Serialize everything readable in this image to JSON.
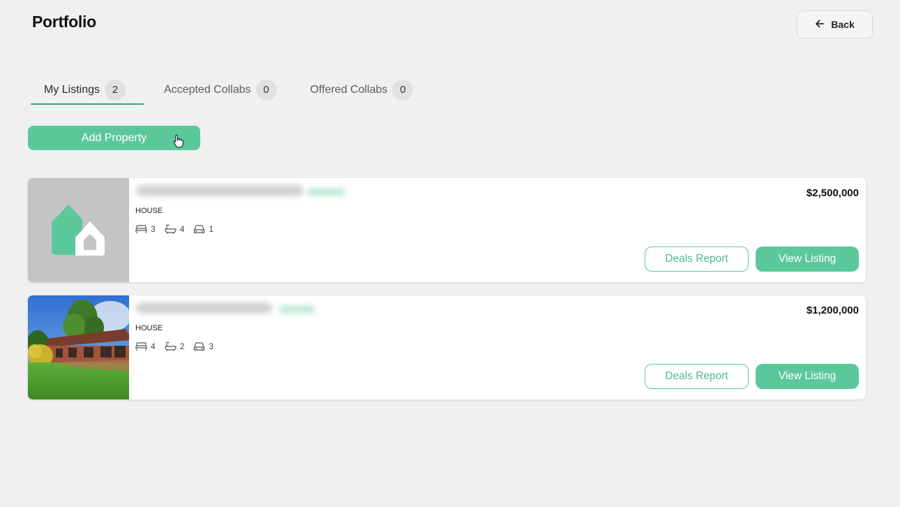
{
  "page": {
    "title": "Portfolio"
  },
  "header": {
    "back_label": "Back"
  },
  "tabs": [
    {
      "label": "My Listings",
      "count": "2",
      "active": true
    },
    {
      "label": "Accepted Collabs",
      "count": "0",
      "active": false
    },
    {
      "label": "Offered Collabs",
      "count": "0",
      "active": false
    }
  ],
  "actions": {
    "add_property_label": "Add Property"
  },
  "listings": [
    {
      "type": "HOUSE",
      "beds": "3",
      "baths": "4",
      "cars": "1",
      "price": "$2,500,000",
      "deals_report_label": "Deals Report",
      "view_listing_label": "View Listing",
      "image": "placeholder-house-logo"
    },
    {
      "type": "HOUSE",
      "beds": "4",
      "baths": "2",
      "cars": "3",
      "price": "$1,200,000",
      "deals_report_label": "Deals Report",
      "view_listing_label": "View Listing",
      "image": "house-photo"
    }
  ],
  "colors": {
    "accent": "#5bc89c",
    "tab_underline": "#3a9f84",
    "background": "#f0f0f1"
  },
  "icons": [
    "arrow-left-icon",
    "bed-icon",
    "bath-icon",
    "car-icon",
    "hand-cursor-icon"
  ]
}
